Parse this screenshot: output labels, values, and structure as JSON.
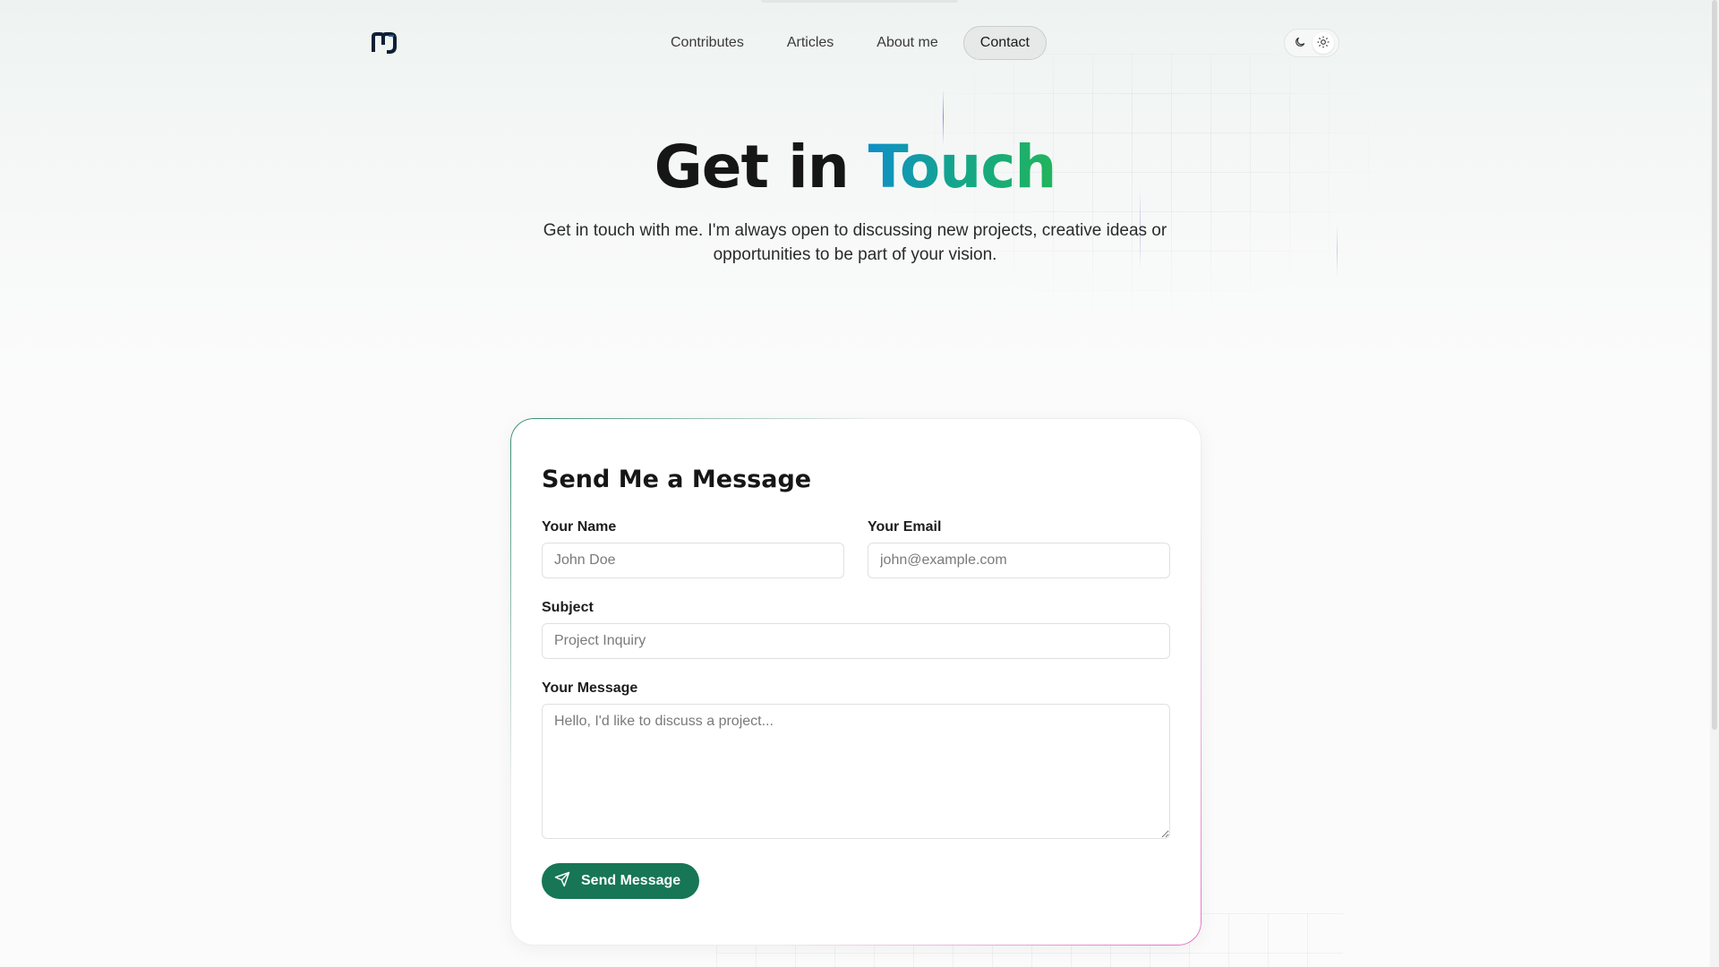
{
  "nav": {
    "items": [
      {
        "label": "Contributes",
        "active": false
      },
      {
        "label": "Articles",
        "active": false
      },
      {
        "label": "About me",
        "active": false
      },
      {
        "label": "Contact",
        "active": true
      }
    ]
  },
  "theme_toggle": {
    "options": [
      "moon-icon",
      "sun-icon"
    ],
    "selected": "sun-icon"
  },
  "hero": {
    "title_plain": "Get in ",
    "title_accent": "Touch",
    "subtitle": "Get in touch with me. I'm always open to discussing new projects, creative ideas or opportunities to be part of your vision."
  },
  "form": {
    "title": "Send Me a Message",
    "name_label": "Your Name",
    "name_placeholder": "John Doe",
    "email_label": "Your Email",
    "email_placeholder": "john@example.com",
    "subject_label": "Subject",
    "subject_placeholder": "Project Inquiry",
    "message_label": "Your Message",
    "message_placeholder": "Hello, I'd like to discuss a project...",
    "submit_label": "Send Message"
  },
  "colors": {
    "accent": "#167656",
    "title_gradient": [
      "#0f8fc8",
      "#22b45c"
    ],
    "card_border_accent": "#e86cc4"
  }
}
